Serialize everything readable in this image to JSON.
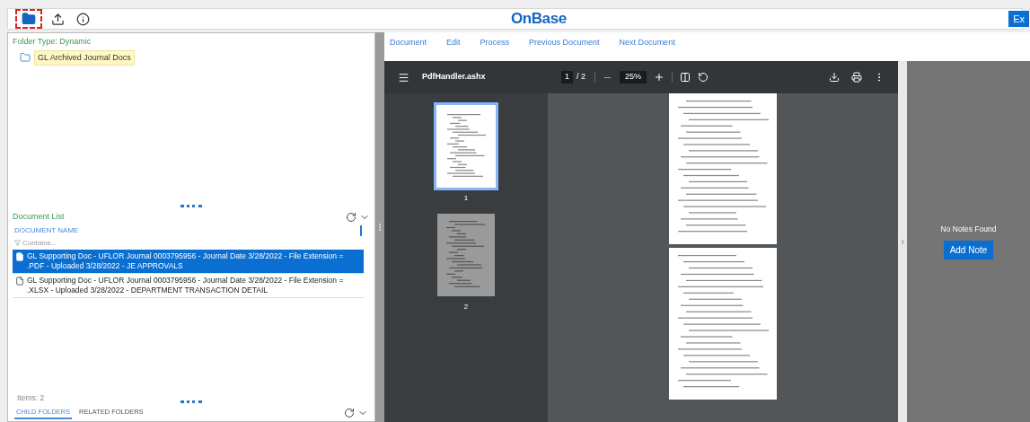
{
  "toolbar": {
    "tools": [
      {
        "kind": "folder",
        "selected": true
      },
      {
        "kind": "upload",
        "selected": false
      },
      {
        "kind": "info",
        "selected": false
      }
    ],
    "logo": "OnBase",
    "right_button": "Ex"
  },
  "folder_panel": {
    "folder_type": "Folder Type: Dynamic",
    "folders": [
      {
        "name": "GL Archived Journal Docs",
        "selected": true
      }
    ]
  },
  "document_list": {
    "title": "Document List",
    "column": "DOCUMENT NAME",
    "filter_placeholder": "Contains...",
    "rows": [
      {
        "text": "GL Supporting Doc - UFLOR Journal 0003795956 - Journal Date 3/28/2022 - File Extension = .PDF - Uploaded 3/28/2022 - JE APPROVALS",
        "selected": true
      },
      {
        "text": "GL Supporting Doc - UFLOR Journal 0003795956 - Journal Date 3/28/2022 - File Extension = .XLSX - Uploaded 3/28/2022 - DEPARTMENT TRANSACTION DETAIL",
        "selected": false
      }
    ],
    "items_count": "Items: 2"
  },
  "bottom_tabs": [
    {
      "label": "CHILD FOLDERS",
      "selected": true
    },
    {
      "label": "RELATED FOLDERS",
      "selected": false
    }
  ],
  "menu": [
    "Document",
    "Edit",
    "Process",
    "Previous Document",
    "Next Document"
  ],
  "viewer": {
    "file_name": "PdfHandler.ashx",
    "page": "1",
    "page_total": "/ 2",
    "zoom": "25%",
    "thumbnails": [
      {
        "label": "1",
        "selected": true
      },
      {
        "label": "2",
        "selected": false
      }
    ]
  },
  "notes": {
    "message": "No Notes Found",
    "button": "Add Note"
  }
}
